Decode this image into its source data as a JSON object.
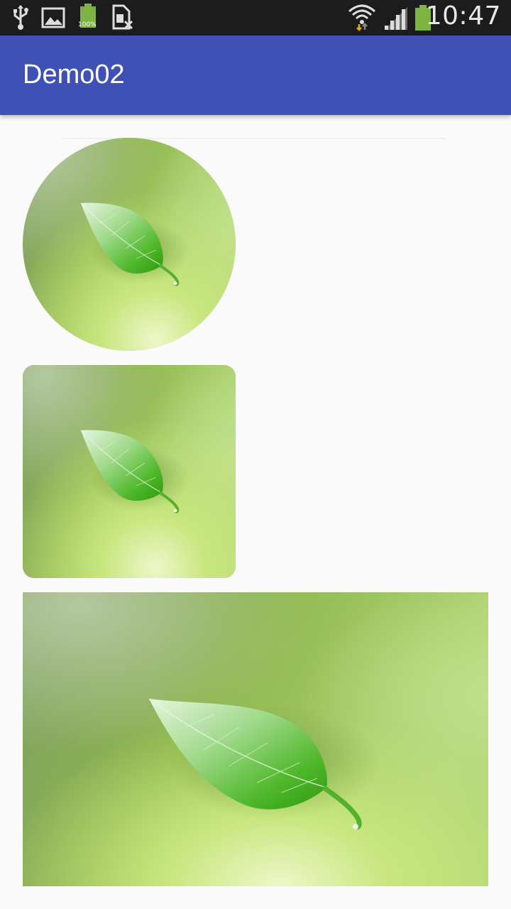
{
  "status_bar": {
    "time": "10:47",
    "battery_percent": "100%",
    "icons": [
      "usb-icon",
      "image-icon",
      "battery-icon",
      "sim-card-off-icon",
      "wifi-icon",
      "signal-icon",
      "battery-full-icon"
    ]
  },
  "app_bar": {
    "title": "Demo02",
    "color": "#3f51b5"
  },
  "images": [
    {
      "name": "leaf-image-circle",
      "shape": "circle"
    },
    {
      "name": "leaf-image-rounded",
      "shape": "rounded-rectangle"
    },
    {
      "name": "leaf-image-rectangle",
      "shape": "rectangle"
    }
  ]
}
